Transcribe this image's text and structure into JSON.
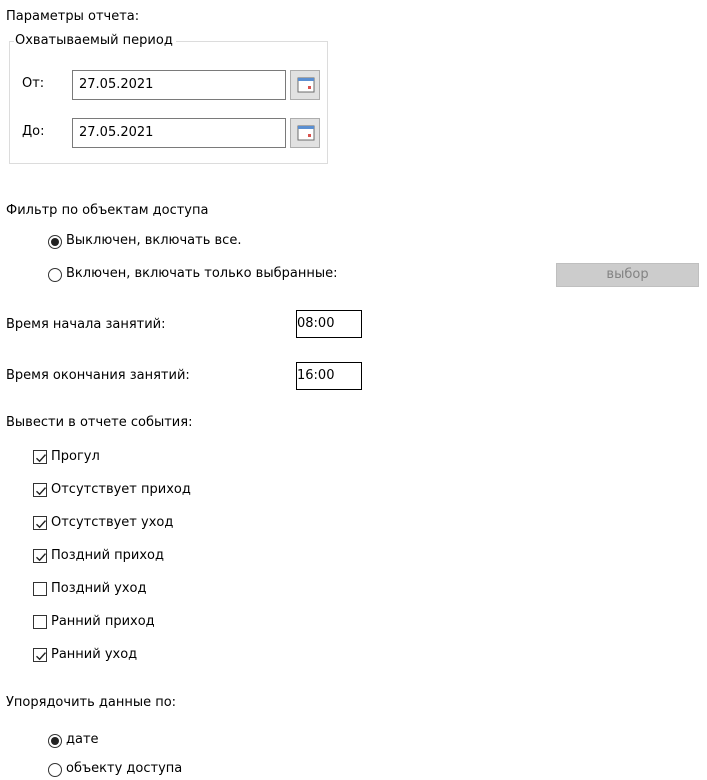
{
  "report_params_title": "Параметры отчета:",
  "period": {
    "legend": "Охватываемый период",
    "from_label": "От:",
    "from_value": "27.05.2021",
    "to_label": "До:",
    "to_value": "27.05.2021",
    "calendar_icon": "calendar-icon"
  },
  "access_filter": {
    "title": "Фильтр по объектам доступа",
    "options": [
      {
        "label": "Выключен, включать все.",
        "checked": true
      },
      {
        "label": "Включен, включать только выбранные:",
        "checked": false
      }
    ],
    "select_button_label": "выбор",
    "select_button_enabled": false
  },
  "class_time": {
    "start_label": "Время начала занятий:",
    "start_value": "08:00",
    "end_label": "Время окончания занятий:",
    "end_value": "16:00"
  },
  "events": {
    "title": "Вывести в отчете события:",
    "items": [
      {
        "label": "Прогул",
        "checked": true
      },
      {
        "label": "Отсутствует приход",
        "checked": true
      },
      {
        "label": "Отсутствует уход",
        "checked": true
      },
      {
        "label": "Поздний приход",
        "checked": true
      },
      {
        "label": "Поздний уход",
        "checked": false
      },
      {
        "label": "Ранний приход",
        "checked": false
      },
      {
        "label": "Ранний уход",
        "checked": true
      }
    ]
  },
  "sort": {
    "title": "Упорядочить данные по:",
    "options": [
      {
        "label": "дате",
        "checked": true
      },
      {
        "label": "объекту доступа",
        "checked": false
      }
    ]
  }
}
